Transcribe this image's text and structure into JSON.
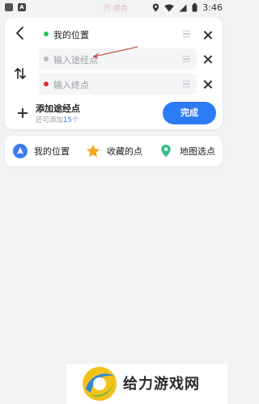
{
  "status_bar": {
    "time": "3:46",
    "ghost_text": "万·德合",
    "icons": [
      "notification-icon",
      "a-icon",
      "location-icon",
      "wifi-icon",
      "signal-icon",
      "battery-icon"
    ]
  },
  "route": {
    "stops": [
      {
        "label": "我的位置",
        "placeholder": "",
        "dot_color": "#2fbf5a",
        "filled": false
      },
      {
        "label": "",
        "placeholder": "输入途经点",
        "dot_color": "#b7b9bd",
        "filled": true
      },
      {
        "label": "",
        "placeholder": "输入终点",
        "dot_color": "#e03131",
        "filled": true
      }
    ],
    "add_stop": {
      "title": "添加途经点",
      "subtitle_prefix": "还可添加",
      "count": "15",
      "subtitle_suffix": "个"
    },
    "done_label": "完成"
  },
  "quick_bar": {
    "items": [
      {
        "label": "我的位置",
        "icon": "my-location-icon",
        "color": "#3d7af2"
      },
      {
        "label": "收藏的点",
        "icon": "star-icon",
        "color": "#f5a623"
      },
      {
        "label": "地图选点",
        "icon": "map-pin-icon",
        "color": "#36c08a"
      }
    ]
  },
  "watermark": {
    "text": "给力游戏网"
  },
  "colors": {
    "accent": "#2d7cf6",
    "background": "#f2f3f5"
  }
}
